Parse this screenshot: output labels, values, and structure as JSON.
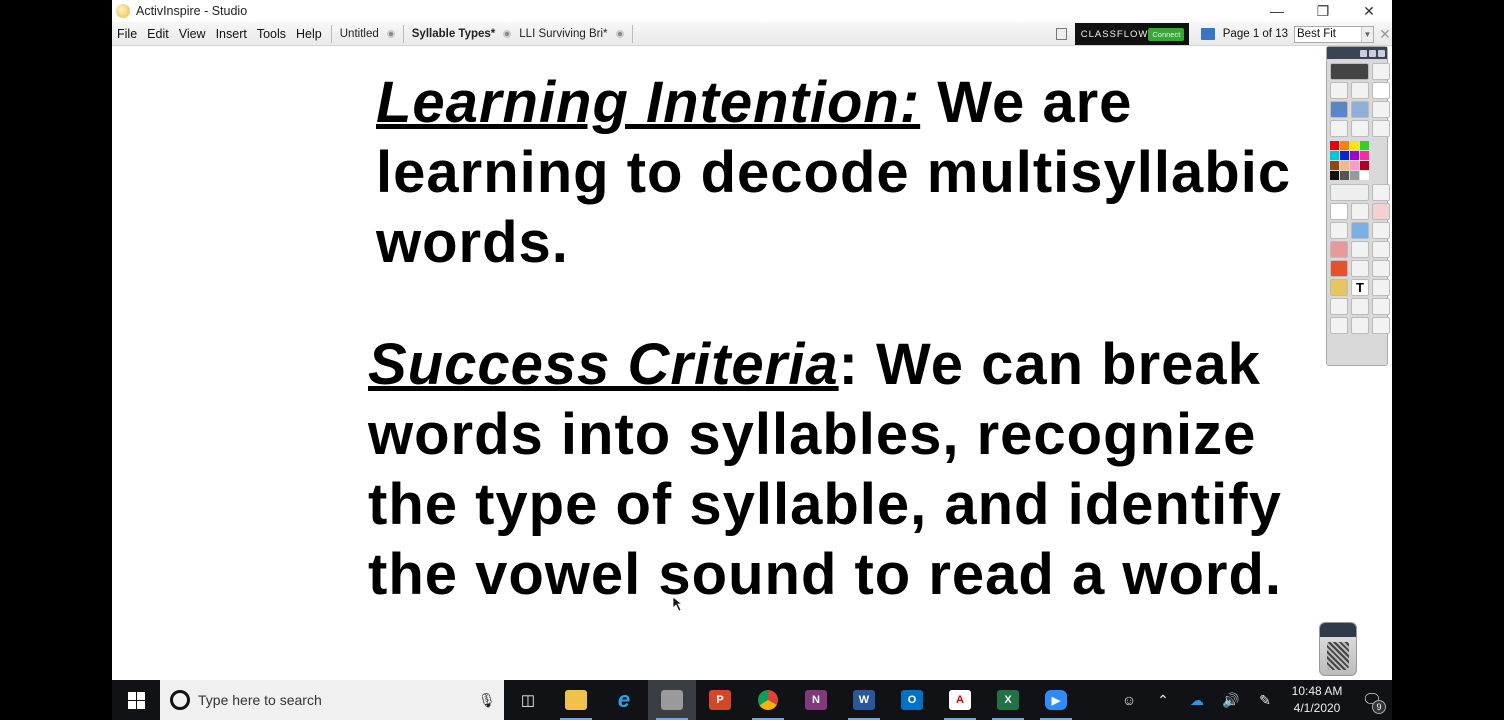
{
  "window": {
    "title": "ActivInspire - Studio",
    "minimize_icon": "minimize-icon",
    "restore_icon": "restore-icon",
    "close_icon": "close-icon"
  },
  "menu": {
    "items": [
      "File",
      "Edit",
      "View",
      "Insert",
      "Tools",
      "Help"
    ]
  },
  "doc_tabs": [
    {
      "label": "Untitled",
      "active": false
    },
    {
      "label": "Syllable Types*",
      "active": true
    },
    {
      "label": "LLI Surviving Bri*",
      "active": false
    }
  ],
  "toolbar_right": {
    "classflow_label": "CLASSFLOW",
    "classflow_connect": "Connect",
    "page_indicator": "Page 1 of 13",
    "zoom_value": "Best Fit"
  },
  "slide": {
    "learning_intention_heading": "Learning Intention:",
    "learning_intention_body": " We are learning to decode multisyllabic words.",
    "success_criteria_heading": "Success Criteria",
    "success_criteria_body": ": We can break words into syllables, recognize the type of syllable, and identify the vowel sound to read a word."
  },
  "toolbox": {
    "colors": [
      "#e8000b",
      "#ff7f00",
      "#ffe600",
      "#2ed22e",
      "#00c8d7",
      "#0a24d8",
      "#a000d0",
      "#ff2aa0",
      "#8a4a10",
      "#f2b88a",
      "#ff99cc",
      "#b00020",
      "#111111",
      "#555555",
      "#999999",
      "#ffffff"
    ]
  },
  "taskbar": {
    "search_placeholder": "Type here to search",
    "apps": [
      "task-view",
      "file-explorer",
      "internet-explorer",
      "activinspire",
      "powerpoint",
      "chrome",
      "onenote",
      "word",
      "outlook",
      "acrobat",
      "excel",
      "zoom"
    ],
    "time": "10:48 AM",
    "date": "4/1/2020",
    "notification_count": "9"
  }
}
